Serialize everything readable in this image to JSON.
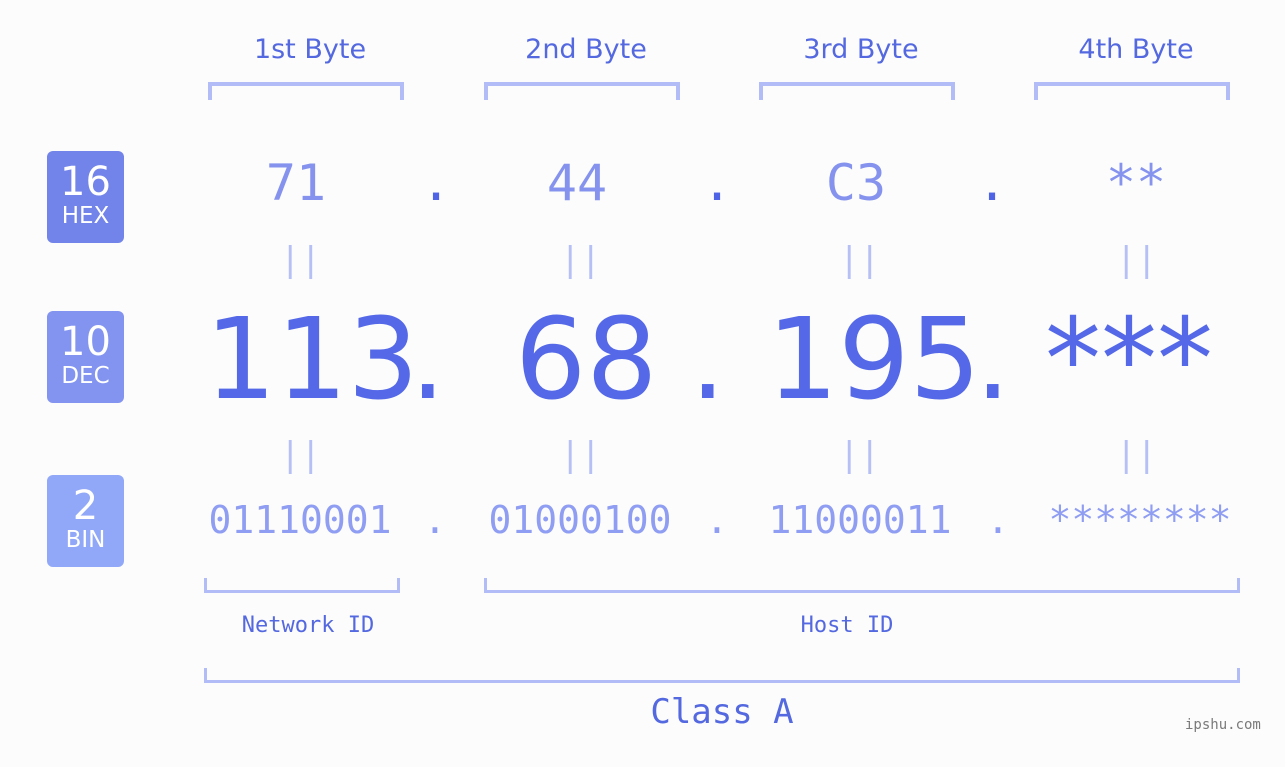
{
  "byte_headers": [
    "1st Byte",
    "2nd Byte",
    "3rd Byte",
    "4th Byte"
  ],
  "badges": [
    {
      "num": "16",
      "label": "HEX",
      "color": "#7284ea"
    },
    {
      "num": "10",
      "label": "DEC",
      "color": "#8294f0"
    },
    {
      "num": "2",
      "label": "BIN",
      "color": "#91a8f8"
    }
  ],
  "hex": [
    "71",
    "44",
    "C3",
    "**"
  ],
  "dec": [
    "113",
    "68",
    "195",
    "***"
  ],
  "bin": [
    "01110001",
    "01000100",
    "11000011",
    "********"
  ],
  "separator": ".",
  "equals": "||",
  "network_id_label": "Network ID",
  "host_id_label": "Host ID",
  "class_label": "Class A",
  "watermark": "ipshu.com"
}
